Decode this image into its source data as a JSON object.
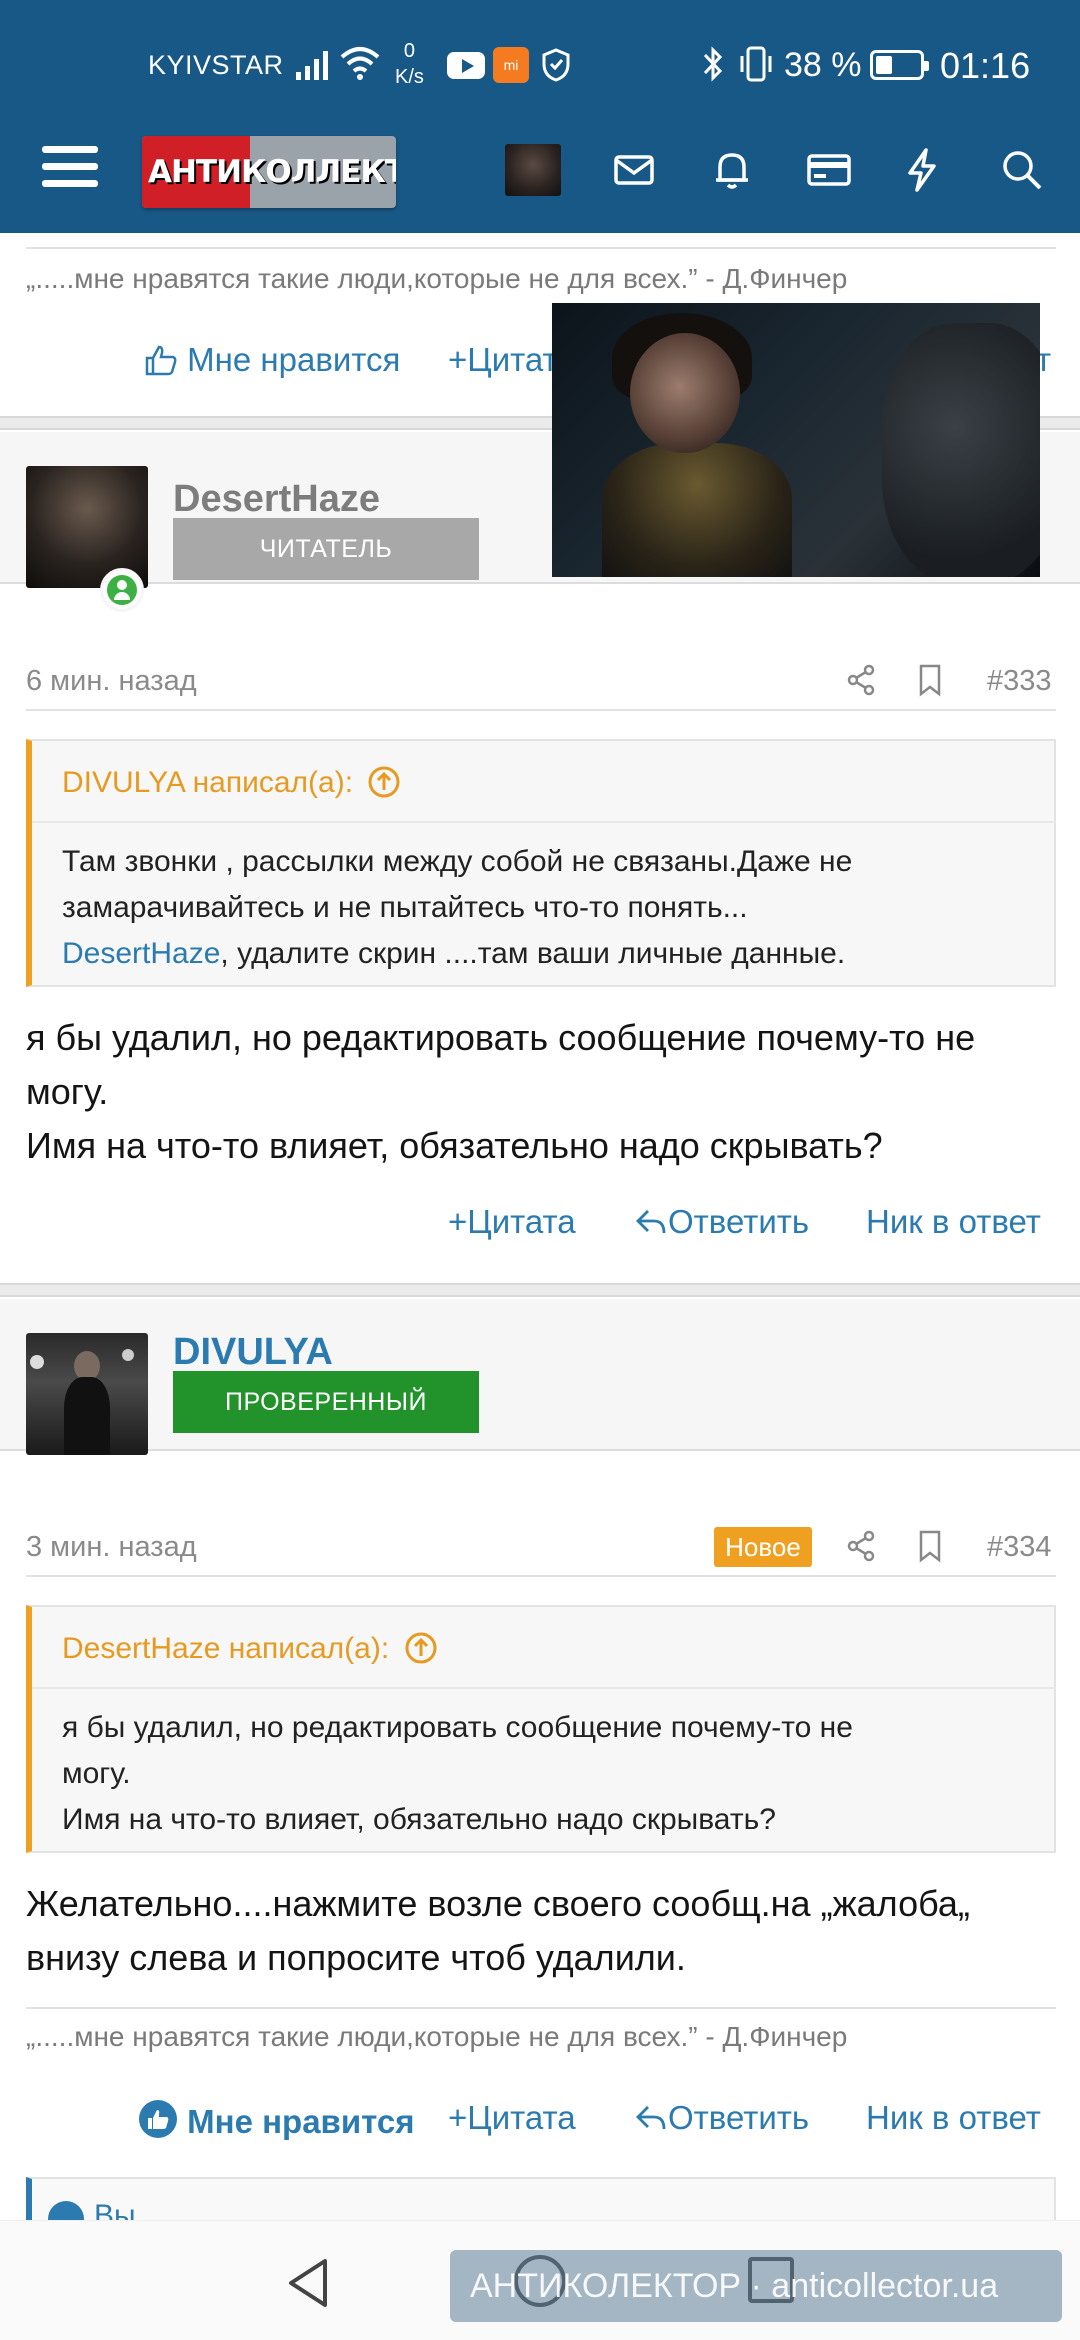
{
  "status_bar": {
    "carrier": "KYIVSTAR",
    "net_speed_value": "0",
    "net_speed_unit": "K/s",
    "mi_label": "mi",
    "battery": "38 %",
    "time": "01:16"
  },
  "header": {
    "logo_text": "АНТИКОЛЛЕКТОР",
    "icons": [
      "menu-icon",
      "avatar",
      "mail-icon",
      "bell-icon",
      "card-icon",
      "lightning-icon",
      "search-icon"
    ]
  },
  "top_fragment": {
    "signature": "„.....мне нравятся такие люди,которые не для всех.” - Д.Финчер",
    "like_label": "Мне нравится",
    "quote_label": "Цитата",
    "reply_label_partial": "т"
  },
  "posts": [
    {
      "username": "DesertHaze",
      "badge": "ЧИТАТЕЛЬ",
      "badge_color": "#a8a8a8",
      "time": "6 мин. назад",
      "number": "#333",
      "quote_author": "DIVULYA написал(а):",
      "quote_lines": [
        "Там звонки , рассылки между собой не связаны.Даже не",
        "замарачивайтесь и не пытайтесь что-то понять...",
        "DesertHaze",
        ", удалите скрин ....там ваши личные данные."
      ],
      "message_lines": [
        "я бы удалил, но редактировать сообщение почему-то не",
        "могу.",
        "Имя на что-то влияет, обязательно надо скрывать?"
      ],
      "actions": [
        "Цитата",
        "Ответить",
        "Ник в ответ"
      ]
    },
    {
      "username": "DIVULYA",
      "badge": "ПРОВЕРЕННЫЙ",
      "badge_color": "#22922a",
      "time": "3 мин. назад",
      "new_label": "Новое",
      "number": "#334",
      "quote_author": "DesertHaze написал(а):",
      "quote_lines": [
        "я бы удалил, но редактировать сообщение почему-то не",
        "могу.",
        "Имя на что-то влияет, обязательно надо скрывать?"
      ],
      "message_lines": [
        "Желательно....нажмите возле своего сообщ.на „жалоба„",
        "внизу слева и попросите чтоб удалили."
      ],
      "signature": "„.....мне нравятся такие люди,которые не для всех.” - Д.Финчер",
      "actions": [
        "Мне нравится",
        "Цитата",
        "Ответить",
        "Ник в ответ"
      ],
      "likes_partial": "Вы"
    }
  ],
  "watermark": "АНТИКОЛЕКТОР · anticollector.ua",
  "colors": {
    "header_blue": "#185886",
    "link_blue": "#2b7bb0",
    "quote_orange": "#e69a1f",
    "new_badge": "#f0a020"
  }
}
